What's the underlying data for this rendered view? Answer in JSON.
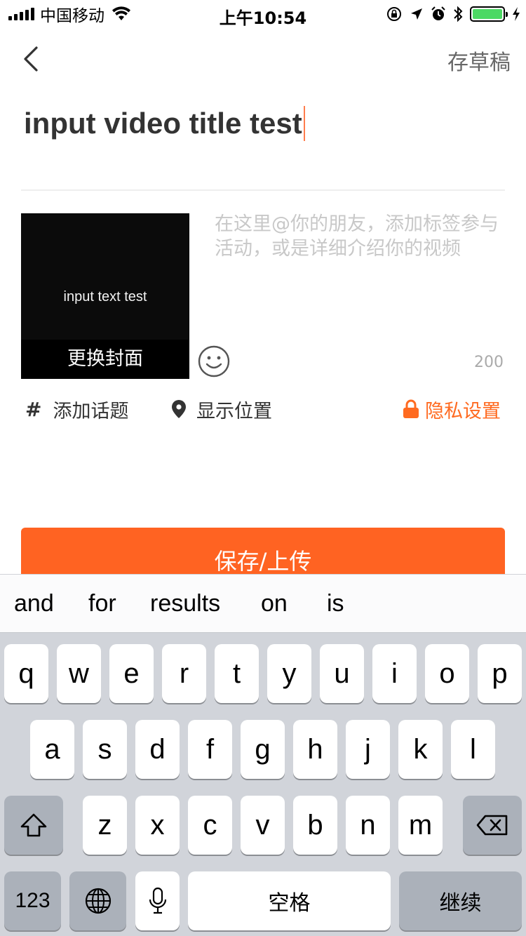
{
  "status_bar": {
    "carrier": "中国移动",
    "time": "上午10:54",
    "battery_level": 1.0,
    "battery_color": "#4cd964"
  },
  "nav": {
    "draft_label": "存草稿"
  },
  "title": {
    "value": "input video title test"
  },
  "cover": {
    "preview_text": "input text test",
    "change_label": "更换封面"
  },
  "description": {
    "placeholder": "在这里@你的朋友，添加标签参与活动，或是详细介绍你的视频",
    "char_count": "200"
  },
  "options": {
    "topic_label": "添加话题",
    "location_label": "显示位置",
    "privacy_label": "隐私设置"
  },
  "save_button": {
    "label": "保存/上传",
    "color": "#ff6322"
  },
  "keyboard": {
    "suggestions": [
      "and",
      "for",
      "results",
      "on",
      "is"
    ],
    "row1": [
      "q",
      "w",
      "e",
      "r",
      "t",
      "y",
      "u",
      "i",
      "o",
      "p"
    ],
    "row2": [
      "a",
      "s",
      "d",
      "f",
      "g",
      "h",
      "j",
      "k",
      "l"
    ],
    "row3": [
      "z",
      "x",
      "c",
      "v",
      "b",
      "n",
      "m"
    ],
    "numbers_label": "123",
    "space_label": "空格",
    "return_label": "继续"
  },
  "colors": {
    "accent": "#ff6a20",
    "keyboard_bg": "#d1d4da"
  }
}
